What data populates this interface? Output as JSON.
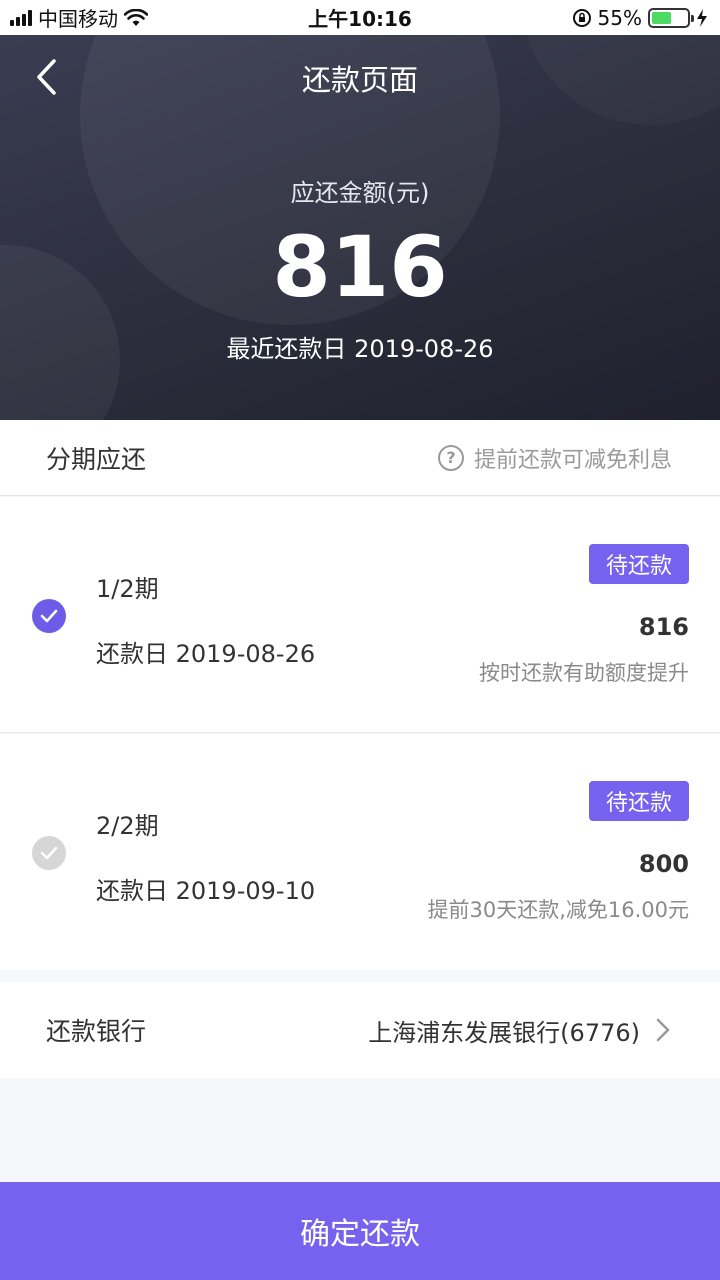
{
  "status_bar": {
    "carrier": "中国移动",
    "time": "上午10:16",
    "battery_percent": "55%",
    "battery_level": 0.55
  },
  "header": {
    "title": "还款页面",
    "amount_label": "应还金额(元)",
    "amount": "816",
    "recent_date": "最近还款日 2019-08-26"
  },
  "installments_section": {
    "title": "分期应还",
    "hint": "提前还款可减免利息"
  },
  "installments": [
    {
      "period": "1/2期",
      "due": "还款日 2019-08-26",
      "badge": "待还款",
      "amount": "816",
      "note": "按时还款有助额度提升",
      "checked": true
    },
    {
      "period": "2/2期",
      "due": "还款日 2019-09-10",
      "badge": "待还款",
      "amount": "800",
      "note": "提前30天还款,减免16.00元",
      "checked": false
    }
  ],
  "bank": {
    "label": "还款银行",
    "value": "上海浦东发展银行(6776)"
  },
  "confirm_label": "确定还款",
  "colors": {
    "accent": "#7662ef",
    "header_dark": "#2b2d3c"
  }
}
